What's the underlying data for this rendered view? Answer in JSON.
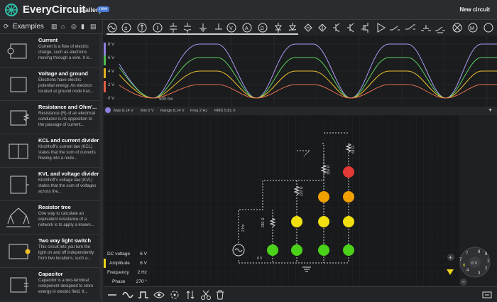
{
  "app": {
    "name": "EveryCircuit",
    "gallery": "Gallery",
    "new_badge": "new",
    "new_circuit": "New circuit"
  },
  "sidebar": {
    "title": "Examples",
    "items": [
      {
        "title": "Current",
        "desc": "Current is a flow of electric charge, such as electrons moving through a wire. It is..."
      },
      {
        "title": "Voltage and ground",
        "desc": "Electrons have electric potential energy. An electron located at ground node has..."
      },
      {
        "title": "Resistance and Ohm'...",
        "desc": "Resistance (R) of an electrical conductor is its opposition to the passage of current..."
      },
      {
        "title": "KCL and current divider",
        "desc": "Kirchhoff's current law (KCL) states that the sum of currents flowing into a node..."
      },
      {
        "title": "KVL and voltage divider",
        "desc": "Kirchhoff's voltage law (KVL) states that the sum of voltages across the..."
      },
      {
        "title": "Resistor tree",
        "desc": "One way to calculate an equivalent resistance of a network is to apply a known..."
      },
      {
        "title": "Two way light switch",
        "desc": "This circuit lets you turn the light on and off independently from two locations, such a..."
      },
      {
        "title": "Capacitor",
        "desc": "Capacitor is a two-terminal component designed to store energy in electric field. It..."
      }
    ]
  },
  "scope": {
    "ylabels": [
      "8 V",
      "6 V",
      "4 V",
      "2 V",
      "0 V"
    ],
    "time_label": "500 ms",
    "stats": {
      "max": "Max  8.14 V",
      "min": "Min  0 V",
      "range": "Range  8.14 V",
      "freq": "Freq  2 Hz",
      "rms": "RMS  5.81 V"
    }
  },
  "circuit": {
    "resistors": [
      "280 Ω",
      "220 Ω",
      "150 Ω",
      "68 Ω"
    ],
    "source_label": "2 Hz",
    "source_voltage": "0 V"
  },
  "props": {
    "rows": [
      {
        "label": "DC voltage",
        "value": "6 V"
      },
      {
        "label": "Amplitude",
        "value": "6 V"
      },
      {
        "label": "Frequency",
        "value": "2 Hz"
      },
      {
        "label": "Phase",
        "value": "270 °"
      }
    ]
  },
  "dial": {
    "center": "6 V",
    "digits": [
      "7",
      "6",
      "5",
      "4",
      "3",
      "2",
      "1",
      "8",
      "9"
    ]
  },
  "colors": {
    "accent": "#e9d21b",
    "led_red": "#e53935",
    "led_orange": "#f0a000",
    "led_yellow": "#f0e010",
    "led_green": "#4cd11a"
  }
}
